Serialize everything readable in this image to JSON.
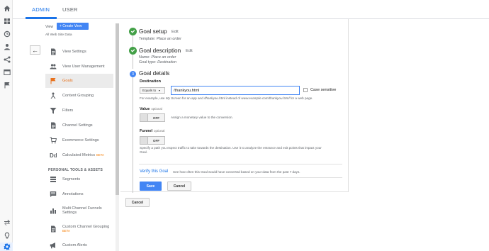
{
  "tabs": {
    "admin": "ADMIN",
    "user": "USER"
  },
  "view": {
    "label": "View",
    "create_button": "+ Create View",
    "subtitle": "All Web Site Data"
  },
  "nav": {
    "items": [
      {
        "label": "View Settings",
        "icon": "document-icon"
      },
      {
        "label": "View User Management",
        "icon": "people-icon"
      },
      {
        "label": "Goals",
        "icon": "flag-icon",
        "active": true
      },
      {
        "label": "Content Grouping",
        "icon": "person-tree-icon"
      },
      {
        "label": "Filters",
        "icon": "filter-icon"
      },
      {
        "label": "Channel Settings",
        "icon": "document-icon"
      },
      {
        "label": "Ecommerce Settings",
        "icon": "cart-icon"
      },
      {
        "label": "Calculated Metrics",
        "beta": "BETA",
        "icon": "dd-icon"
      }
    ],
    "section_title": "PERSONAL TOOLS & ASSETS",
    "tools": [
      {
        "label": "Segments",
        "icon": "segments-icon"
      },
      {
        "label": "Annotations",
        "icon": "comment-icon"
      },
      {
        "label": "Multi Channel Funnels",
        "label2": "Settings",
        "icon": "bar-chart-icon"
      },
      {
        "label": "Custom Channel Grouping",
        "beta": "BETA",
        "icon": "document-icon"
      },
      {
        "label": "Custom Alerts",
        "icon": "megaphone-icon"
      }
    ]
  },
  "goal_setup": {
    "title": "Goal setup",
    "edit": "Edit",
    "template_label": "Template:",
    "template_value": "Place an order"
  },
  "goal_description": {
    "title": "Goal description",
    "edit": "Edit",
    "name_label": "Name:",
    "name_value": "Place an order",
    "type_label": "Goal type:",
    "type_value": "Destination"
  },
  "goal_details": {
    "step_number": "3",
    "title": "Goal details",
    "destination_label": "Destination",
    "match_type": "Equals to",
    "destination_value": "/thankyou.html",
    "case_sensitive": "Case sensitive",
    "destination_help_prefix": "For example, use",
    "destination_help_ex1": "My Screen",
    "destination_help_mid1": "for an app and",
    "destination_help_ex2": "/thankyou.html",
    "destination_help_mid2": "instead of",
    "destination_help_ex3": "www.example.com/thankyou.html",
    "destination_help_suffix": "for a web page.",
    "value_label": "Value",
    "value_optional": "optional",
    "value_toggle": "OFF",
    "value_help": "Assign a monetary value to the conversion.",
    "funnel_label": "Funnel",
    "funnel_optional": "optional",
    "funnel_toggle": "OFF",
    "funnel_help_line1": "Specify a path you expect traffic to take towards the destination. Use it to analyze the entrance and exit points that impact your",
    "funnel_help_line2": "Goal.",
    "verify_link": "Verify this Goal",
    "verify_note": "See how often this Goal would have converted based on your data from the past 7 days.",
    "save_button": "Save",
    "cancel_button": "Cancel"
  },
  "footer": {
    "cancel_button": "Cancel"
  },
  "colors": {
    "accent": "#1a73e8",
    "primary_button": "#4285f4",
    "check_green": "#43a047",
    "active_nav": "#e8711c",
    "beta": "#f57c00"
  }
}
